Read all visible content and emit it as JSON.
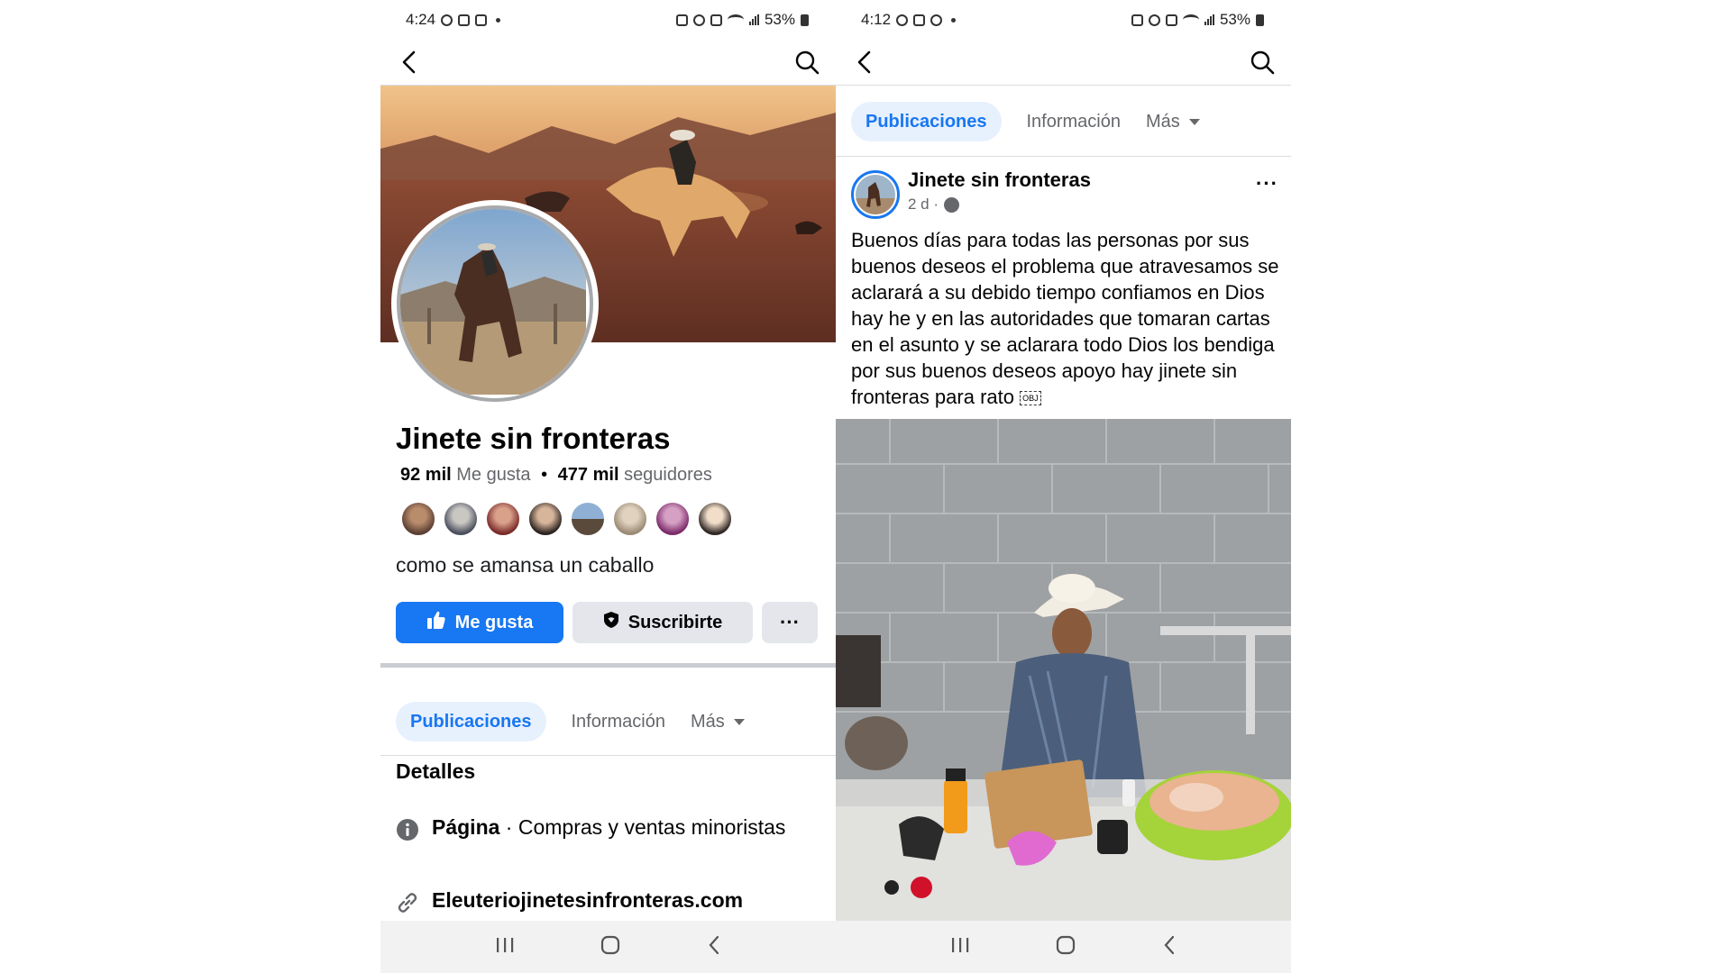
{
  "left_screen": {
    "status": {
      "time": "4:24",
      "battery": "53%"
    },
    "page": {
      "name": "Jinete sin fronteras",
      "likes_count": "92 mil",
      "likes_label": "Me gusta",
      "separator": "•",
      "followers_count": "477 mil",
      "followers_label": "seguidores",
      "bio": "como se amansa un caballo"
    },
    "actions": {
      "like_label": "Me gusta",
      "subscribe_label": "Suscribirte",
      "more_label": "···"
    },
    "tabs": {
      "posts": "Publicaciones",
      "info": "Información",
      "more": "Más"
    },
    "details": {
      "title": "Detalles",
      "category_label": "Página",
      "category_value": " · Compras y ventas minoristas",
      "website": "Eleuteriojinetesinfronteras.com"
    }
  },
  "right_screen": {
    "status": {
      "time": "4:12",
      "battery": "53%"
    },
    "tabs": {
      "posts": "Publicaciones",
      "info": "Información",
      "more": "Más"
    },
    "post": {
      "author": "Jinete sin fronteras",
      "time": "2 d ·",
      "more_label": "···",
      "text": "Buenos días para todas las personas por sus buenos deseos el problema que atravesamos se aclarará a su debido tiempo confiamos en Dios hay he y en las autoridades que tomaran cartas en el asunto y se aclarara todo  Dios los bendiga por sus buenos deseos apoyo hay jinete sin fronteras para rato",
      "obj_glyph": "OBJ"
    }
  },
  "colors": {
    "accent": "#1877f2",
    "tab_active_bg": "#e7f0fd",
    "secondary_button": "#e4e6eb",
    "muted_text": "#65676b"
  },
  "icons": [
    "back-arrow-icon",
    "search-icon",
    "thumbs-up-icon",
    "shield-icon",
    "info-icon",
    "link-icon",
    "globe-icon",
    "recent-apps-icon",
    "home-icon",
    "nav-back-icon"
  ]
}
